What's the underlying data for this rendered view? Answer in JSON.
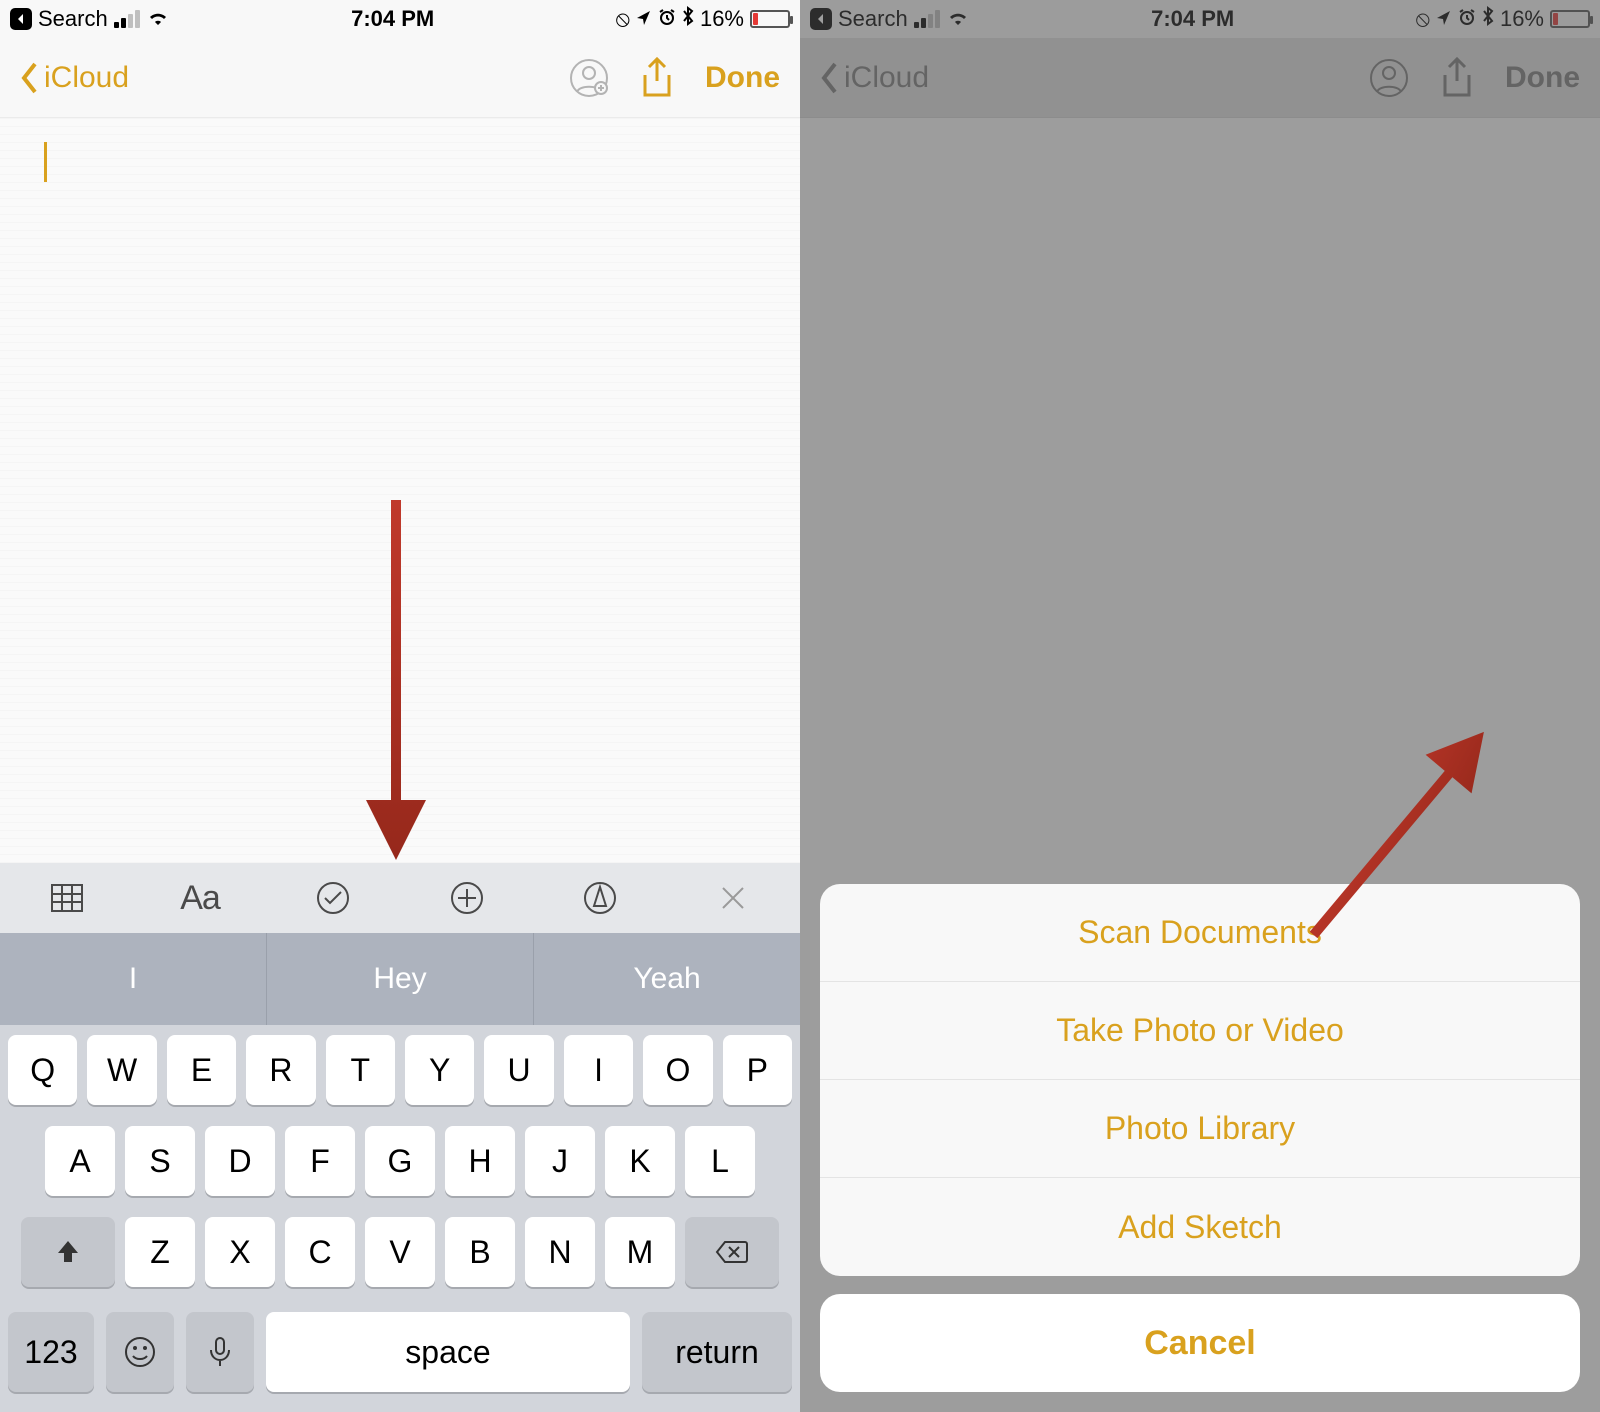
{
  "status": {
    "search_label": "Search",
    "time": "7:04 PM",
    "battery_text": "16%"
  },
  "nav": {
    "back_label": "iCloud",
    "done_label": "Done"
  },
  "predictions": [
    "I",
    "Hey",
    "Yeah"
  ],
  "keyboard": {
    "row1": [
      "Q",
      "W",
      "E",
      "R",
      "T",
      "Y",
      "U",
      "I",
      "O",
      "P"
    ],
    "row2": [
      "A",
      "S",
      "D",
      "F",
      "G",
      "H",
      "J",
      "K",
      "L"
    ],
    "row3": [
      "Z",
      "X",
      "C",
      "V",
      "B",
      "N",
      "M"
    ],
    "num_key": "123",
    "space_key": "space",
    "return_key": "return"
  },
  "action_sheet": {
    "items": [
      "Scan Documents",
      "Take Photo or Video",
      "Photo Library",
      "Add Sketch"
    ],
    "cancel": "Cancel"
  },
  "format_row": {
    "aa": "Aa"
  }
}
